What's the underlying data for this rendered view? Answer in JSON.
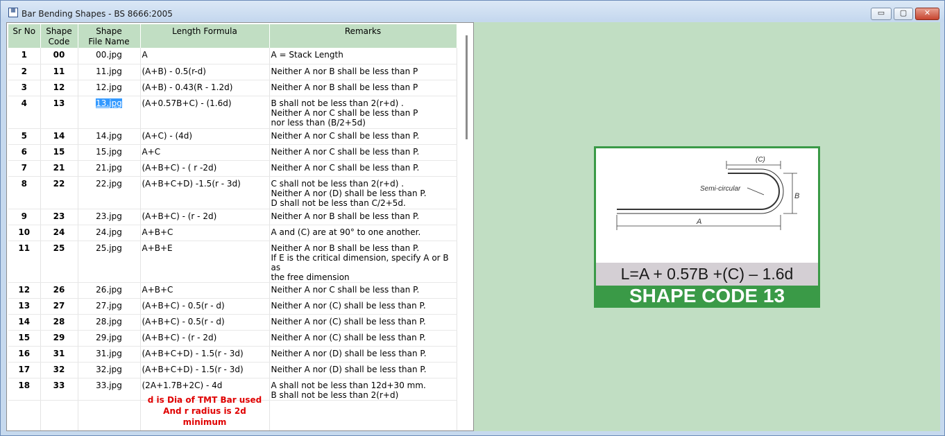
{
  "window": {
    "title": "Bar Bending Shapes - BS 8666:2005",
    "min_label": "▭",
    "max_label": "▢",
    "close_label": "✕"
  },
  "table": {
    "headers": [
      "Sr No",
      "Shape\nCode",
      "Shape\nFile Name",
      "Length Formula",
      "Remarks"
    ],
    "rows": [
      {
        "sr": "1",
        "code": "00",
        "file": "00.jpg",
        "formula": "A",
        "remarks": "A = Stack Length"
      },
      {
        "sr": "2",
        "code": "11",
        "file": "11.jpg",
        "formula": "(A+B) - 0.5(r-d)",
        "remarks": "Neither A nor B shall be less than P"
      },
      {
        "sr": "3",
        "code": "12",
        "file": "12.jpg",
        "formula": "(A+B) - 0.43(R - 1.2d)",
        "remarks": "Neither A nor B shall be less than P"
      },
      {
        "sr": "4",
        "code": "13",
        "file": "13.jpg",
        "formula": "(A+0.57B+C) - (1.6d)",
        "remarks": "B shall not be less than 2(r+d) .\nNeither A nor C shall be less than P\nnor less than (B/2+5d)",
        "selected": true
      },
      {
        "sr": "5",
        "code": "14",
        "file": "14.jpg",
        "formula": "(A+C) - (4d)",
        "remarks": "Neither A nor C shall be less than P."
      },
      {
        "sr": "6",
        "code": "15",
        "file": "15.jpg",
        "formula": "A+C",
        "remarks": "Neither A nor C shall be less than P."
      },
      {
        "sr": "7",
        "code": "21",
        "file": "21.jpg",
        "formula": "(A+B+C) - ( r -2d)",
        "remarks": "Neither A nor C shall be less than P."
      },
      {
        "sr": "8",
        "code": "22",
        "file": "22.jpg",
        "formula": "(A+B+C+D) -1.5(r - 3d)",
        "remarks": "C shall not be less than 2(r+d) .\nNeither A nor (D) shall be less than P.\nD shall not be less than C/2+5d."
      },
      {
        "sr": "9",
        "code": "23",
        "file": "23.jpg",
        "formula": "(A+B+C) - (r - 2d)",
        "remarks": "Neither A nor B shall be less than P."
      },
      {
        "sr": "10",
        "code": "24",
        "file": "24.jpg",
        "formula": "A+B+C",
        "remarks": "A and (C) are at 90° to one another."
      },
      {
        "sr": "11",
        "code": "25",
        "file": "25.jpg",
        "formula": "A+B+E",
        "remarks": "Neither A nor B shall be less than P.\nIf E is the critical dimension, specify A or B as\nthe free dimension"
      },
      {
        "sr": "12",
        "code": "26",
        "file": "26.jpg",
        "formula": "A+B+C",
        "remarks": "Neither A nor C shall be less than P."
      },
      {
        "sr": "13",
        "code": "27",
        "file": "27.jpg",
        "formula": "(A+B+C) - 0.5(r - d)",
        "remarks": "Neither A nor (C) shall be less than P."
      },
      {
        "sr": "14",
        "code": "28",
        "file": "28.jpg",
        "formula": "(A+B+C) - 0.5(r - d)",
        "remarks": "Neither A nor (C) shall be less than P."
      },
      {
        "sr": "15",
        "code": "29",
        "file": "29.jpg",
        "formula": "(A+B+C) - (r - 2d)",
        "remarks": "Neither A nor (C) shall be less than P."
      },
      {
        "sr": "16",
        "code": "31",
        "file": "31.jpg",
        "formula": "(A+B+C+D) - 1.5(r - 3d)",
        "remarks": "Neither A nor (D) shall be less than P."
      },
      {
        "sr": "17",
        "code": "32",
        "file": "32.jpg",
        "formula": "(A+B+C+D) - 1.5(r - 3d)",
        "remarks": "Neither A nor (D) shall be less than P."
      },
      {
        "sr": "18",
        "code": "33",
        "file": "33.jpg",
        "formula": "(2A+1.7B+2C) - 4d",
        "remarks": "A shall not be less than 12d+30 mm.\nB shall not be less than 2(r+d)"
      }
    ]
  },
  "note": {
    "line1": "d is Dia of TMT Bar used",
    "line2": "And r radius is 2d minimum"
  },
  "preview": {
    "label_c": "(C)",
    "label_semicircular": "Semi-circular",
    "label_b": "B",
    "label_a": "A",
    "formula": "L=A + 0.57B +(C) – 1.6d",
    "shape_code": "SHAPE CODE 13"
  }
}
